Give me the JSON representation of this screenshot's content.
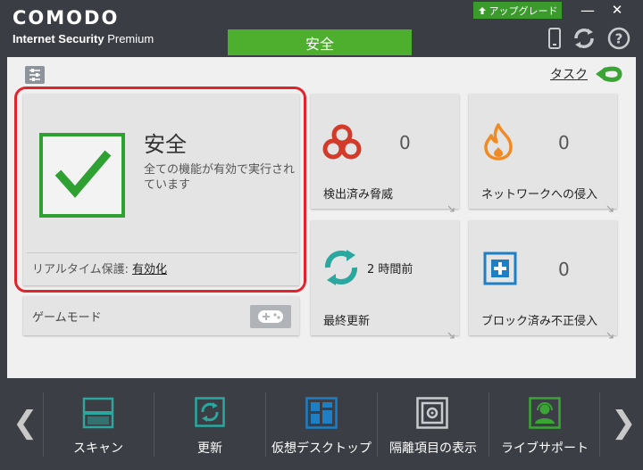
{
  "window": {
    "logo": "COMODO",
    "product_bold": "Internet Security",
    "product_rest": " Premium",
    "upgrade_label": "アップグレード",
    "minimize_symbol": "—",
    "close_symbol": "✕",
    "status_tab": "安全",
    "icons": [
      "phone-icon",
      "refresh-sync-icon",
      "help-icon"
    ]
  },
  "main": {
    "task_link": "タスク",
    "status": {
      "title": "安全",
      "description": "全ての機能が有効で実行されています",
      "realtime_label": "リアルタイム保護:",
      "realtime_value": "有効化"
    },
    "game_mode": {
      "label": "ゲームモード"
    },
    "tiles": [
      {
        "label": "検出済み脅威",
        "value": "0",
        "icon": "biohazard-icon"
      },
      {
        "label": "ネットワークへの侵入",
        "value": "0",
        "icon": "flame-icon"
      },
      {
        "label": "最終更新",
        "value": "2 時間前",
        "icon": "update-cycle-icon"
      },
      {
        "label": "ブロック済み不正侵入",
        "value": "0",
        "icon": "shield-plus-icon"
      }
    ]
  },
  "bottom_nav": {
    "items": [
      {
        "label": "スキャン",
        "icon": "scan-icon"
      },
      {
        "label": "更新",
        "icon": "update-icon"
      },
      {
        "label": "仮想デスクトップ",
        "icon": "virtual-desktop-icon"
      },
      {
        "label": "隔離項目の表示",
        "icon": "quarantine-icon"
      },
      {
        "label": "ライブサポート",
        "icon": "live-support-icon"
      }
    ],
    "prev_symbol": "❮",
    "next_symbol": "❯"
  },
  "colors": {
    "accent_green": "#4eae2e",
    "highlight_red": "#e0242c",
    "teal": "#2aa8a0",
    "threat_red": "#d23a2a",
    "flame_orange": "#f08a24",
    "shield_blue": "#1e7fc4"
  }
}
